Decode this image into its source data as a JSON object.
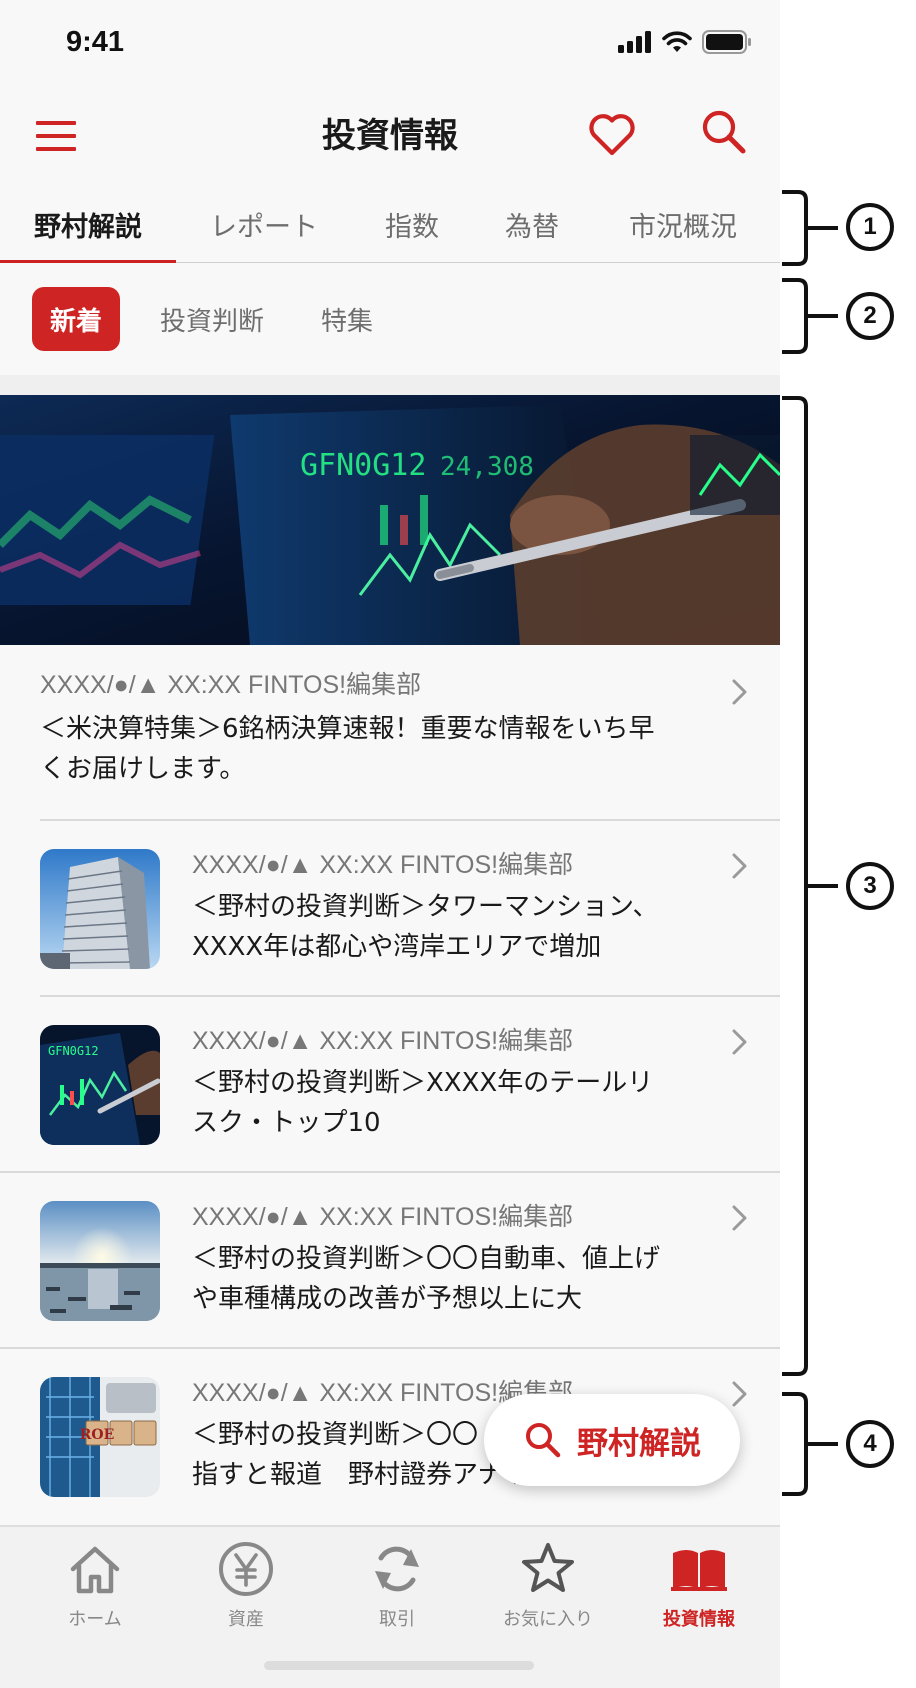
{
  "status_bar": {
    "time": "9:41"
  },
  "header": {
    "title": "投資情報"
  },
  "tabs": [
    {
      "label": "野村解説",
      "active": true
    },
    {
      "label": "レポート"
    },
    {
      "label": "指数"
    },
    {
      "label": "為替"
    },
    {
      "label": "市況概況"
    }
  ],
  "subtabs": [
    {
      "label": "新着",
      "active": true
    },
    {
      "label": "投資判断"
    },
    {
      "label": "特集"
    }
  ],
  "feed": {
    "hero": {
      "meta": "XXXX/●/▲ XX:XX  FINTOS!編集部",
      "title_line1": "＜米決算特集＞6銘柄決算速報！重要な情報をいち早",
      "title_line2": "くお届けします。"
    },
    "items": [
      {
        "meta": "XXXX/●/▲ XX:XX  FINTOS!編集部",
        "title_line1": "＜野村の投資判断＞タワーマンション、",
        "title_line2": "XXXX年は都心や湾岸エリアで増加",
        "thumb": "tower-building"
      },
      {
        "meta": "XXXX/●/▲ XX:XX  FINTOS!編集部",
        "title_line1": "＜野村の投資判断＞XXXX年のテールリ",
        "title_line2": "スク・トップ10",
        "thumb": "stock-screen"
      },
      {
        "meta": "XXXX/●/▲ XX:XX  FINTOS!編集部",
        "title_line1": "＜野村の投資判断＞〇〇自動車、値上げ",
        "title_line2": "や車種構成の改善が予想以上に大",
        "thumb": "harbor-sunset"
      },
      {
        "meta": "XXXX/●/▲ XX:XX  FINTOS!編集部",
        "title_line1": "＜野村の投資判断＞〇〇",
        "title_line2": "指すと報道　野村證券アナリストの見方",
        "thumb": "roe-blocks",
        "thumb_text": "ROE"
      }
    ]
  },
  "fab": {
    "label": "野村解説"
  },
  "tabbar": [
    {
      "label": "ホーム",
      "icon": "home-icon"
    },
    {
      "label": "資産",
      "icon": "yen-icon"
    },
    {
      "label": "取引",
      "icon": "refresh-icon"
    },
    {
      "label": "お気に入り",
      "icon": "star-icon"
    },
    {
      "label": "投資情報",
      "icon": "book-icon",
      "active": true
    }
  ],
  "annotations": [
    "1",
    "2",
    "3",
    "4"
  ],
  "colors": {
    "accent": "#cf2424",
    "background": "#f8f8f8"
  }
}
